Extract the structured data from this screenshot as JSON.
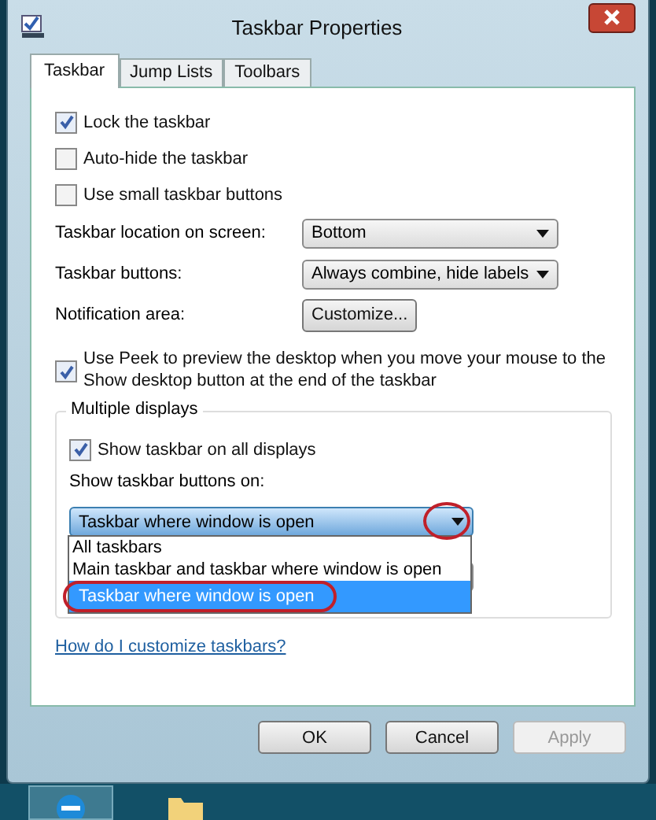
{
  "window": {
    "title": "Taskbar Properties"
  },
  "tabs": [
    {
      "label": "Taskbar",
      "selected": true
    },
    {
      "label": "Jump Lists",
      "selected": false
    },
    {
      "label": "Toolbars",
      "selected": false
    }
  ],
  "options": [
    {
      "label": "Lock the taskbar",
      "checked": true
    },
    {
      "label": "Auto-hide the taskbar",
      "checked": false
    },
    {
      "label": "Use small taskbar buttons",
      "checked": false
    }
  ],
  "settings": [
    {
      "kind": "dropdown",
      "label": "Taskbar location on screen:",
      "value": "Bottom"
    },
    {
      "kind": "dropdown",
      "label": "Taskbar buttons:",
      "value": "Always combine, hide labels"
    },
    {
      "kind": "button",
      "label": "Notification area:",
      "value": "Customize..."
    }
  ],
  "peek": {
    "label": "Use Peek to preview the desktop when you move your mouse to the Show desktop button at the end of the taskbar",
    "checked": true
  },
  "multiple_displays": {
    "title": "Multiple displays",
    "show_all": {
      "label": "Show taskbar on all displays",
      "checked": true
    },
    "buttons_on_label": "Show taskbar buttons on:",
    "buttons_on": {
      "value": "Taskbar where window is open",
      "options": [
        {
          "label": "All taskbars",
          "selected": false
        },
        {
          "label": "Main taskbar and taskbar where window is open",
          "selected": false
        },
        {
          "label": "Taskbar where window is open",
          "selected": true
        }
      ]
    }
  },
  "help_link": "How do I customize taskbars?",
  "buttons": [
    {
      "label": "OK",
      "disabled": false
    },
    {
      "label": "Cancel",
      "disabled": false
    },
    {
      "label": "Apply",
      "disabled": true
    }
  ]
}
